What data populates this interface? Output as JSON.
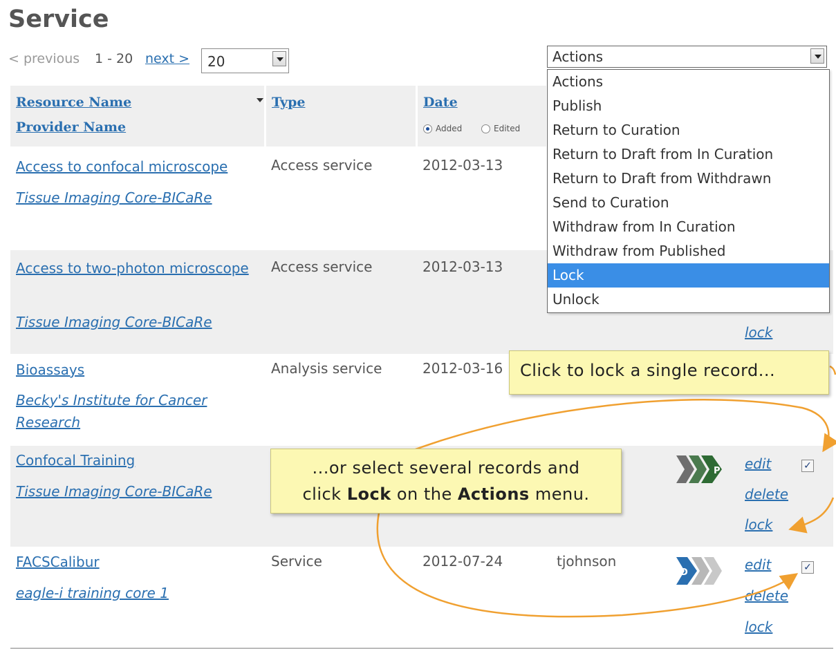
{
  "page": {
    "title": "Service"
  },
  "pager": {
    "previous": "< previous",
    "range": "1 - 20",
    "next": "next >",
    "page_size": "20"
  },
  "actions": {
    "selected": "Actions",
    "options": [
      "Actions",
      "Publish",
      "Return to Curation",
      "Return to Draft from In Curation",
      "Return to Draft from Withdrawn",
      "Send to Curation",
      "Withdraw from In Curation",
      "Withdraw from Published",
      "Lock",
      "Unlock"
    ],
    "highlighted": "Lock"
  },
  "columns": {
    "resource_name": "Resource Name",
    "provider_name": "Provider Name",
    "type": "Type",
    "date": "Date",
    "added": "Added",
    "edited": "Edited"
  },
  "rows": [
    {
      "name": "Access to confocal microscope",
      "provider": "Tissue Imaging Core-BICaRe",
      "type": "Access service",
      "date": "2012-03-13"
    },
    {
      "name": "Access to two-photon microscope",
      "provider": "Tissue Imaging Core-BICaRe",
      "type": "Access service",
      "date": "2012-03-13",
      "lock": "lock"
    },
    {
      "name": "Bioassays",
      "provider": "Becky's Institute for Cancer Research",
      "type": "Analysis service",
      "date": "2012-03-16"
    },
    {
      "name": "Confocal Training",
      "provider": "Tissue Imaging Core-BICaRe",
      "status_badge": "P",
      "edit": "edit",
      "delete": "delete",
      "lock": "lock",
      "checked": true
    },
    {
      "name": "FACSCalibur",
      "provider": "eagle-i training core 1",
      "type": "Service",
      "date": "2012-07-24",
      "owner": "tjohnson",
      "status_badge": "D",
      "edit": "edit",
      "delete": "delete",
      "lock": "lock",
      "checked": true
    }
  ],
  "callouts": {
    "single": "Click to lock a single record...",
    "multi_line1": "...or select several records and",
    "multi_pre": "click ",
    "multi_bold1": "Lock",
    "multi_mid": " on the ",
    "multi_bold2": "Actions",
    "multi_post": " menu."
  },
  "colors": {
    "link": "#2a6fb0",
    "row_alt": "#efefef",
    "highlight": "#3a8ee6",
    "callout_bg": "#fcf8b3",
    "arrow": "#f0a030",
    "badge_green": "#2e6b34",
    "badge_blue": "#2a6fb0",
    "badge_gray": "#b8b8b8"
  }
}
